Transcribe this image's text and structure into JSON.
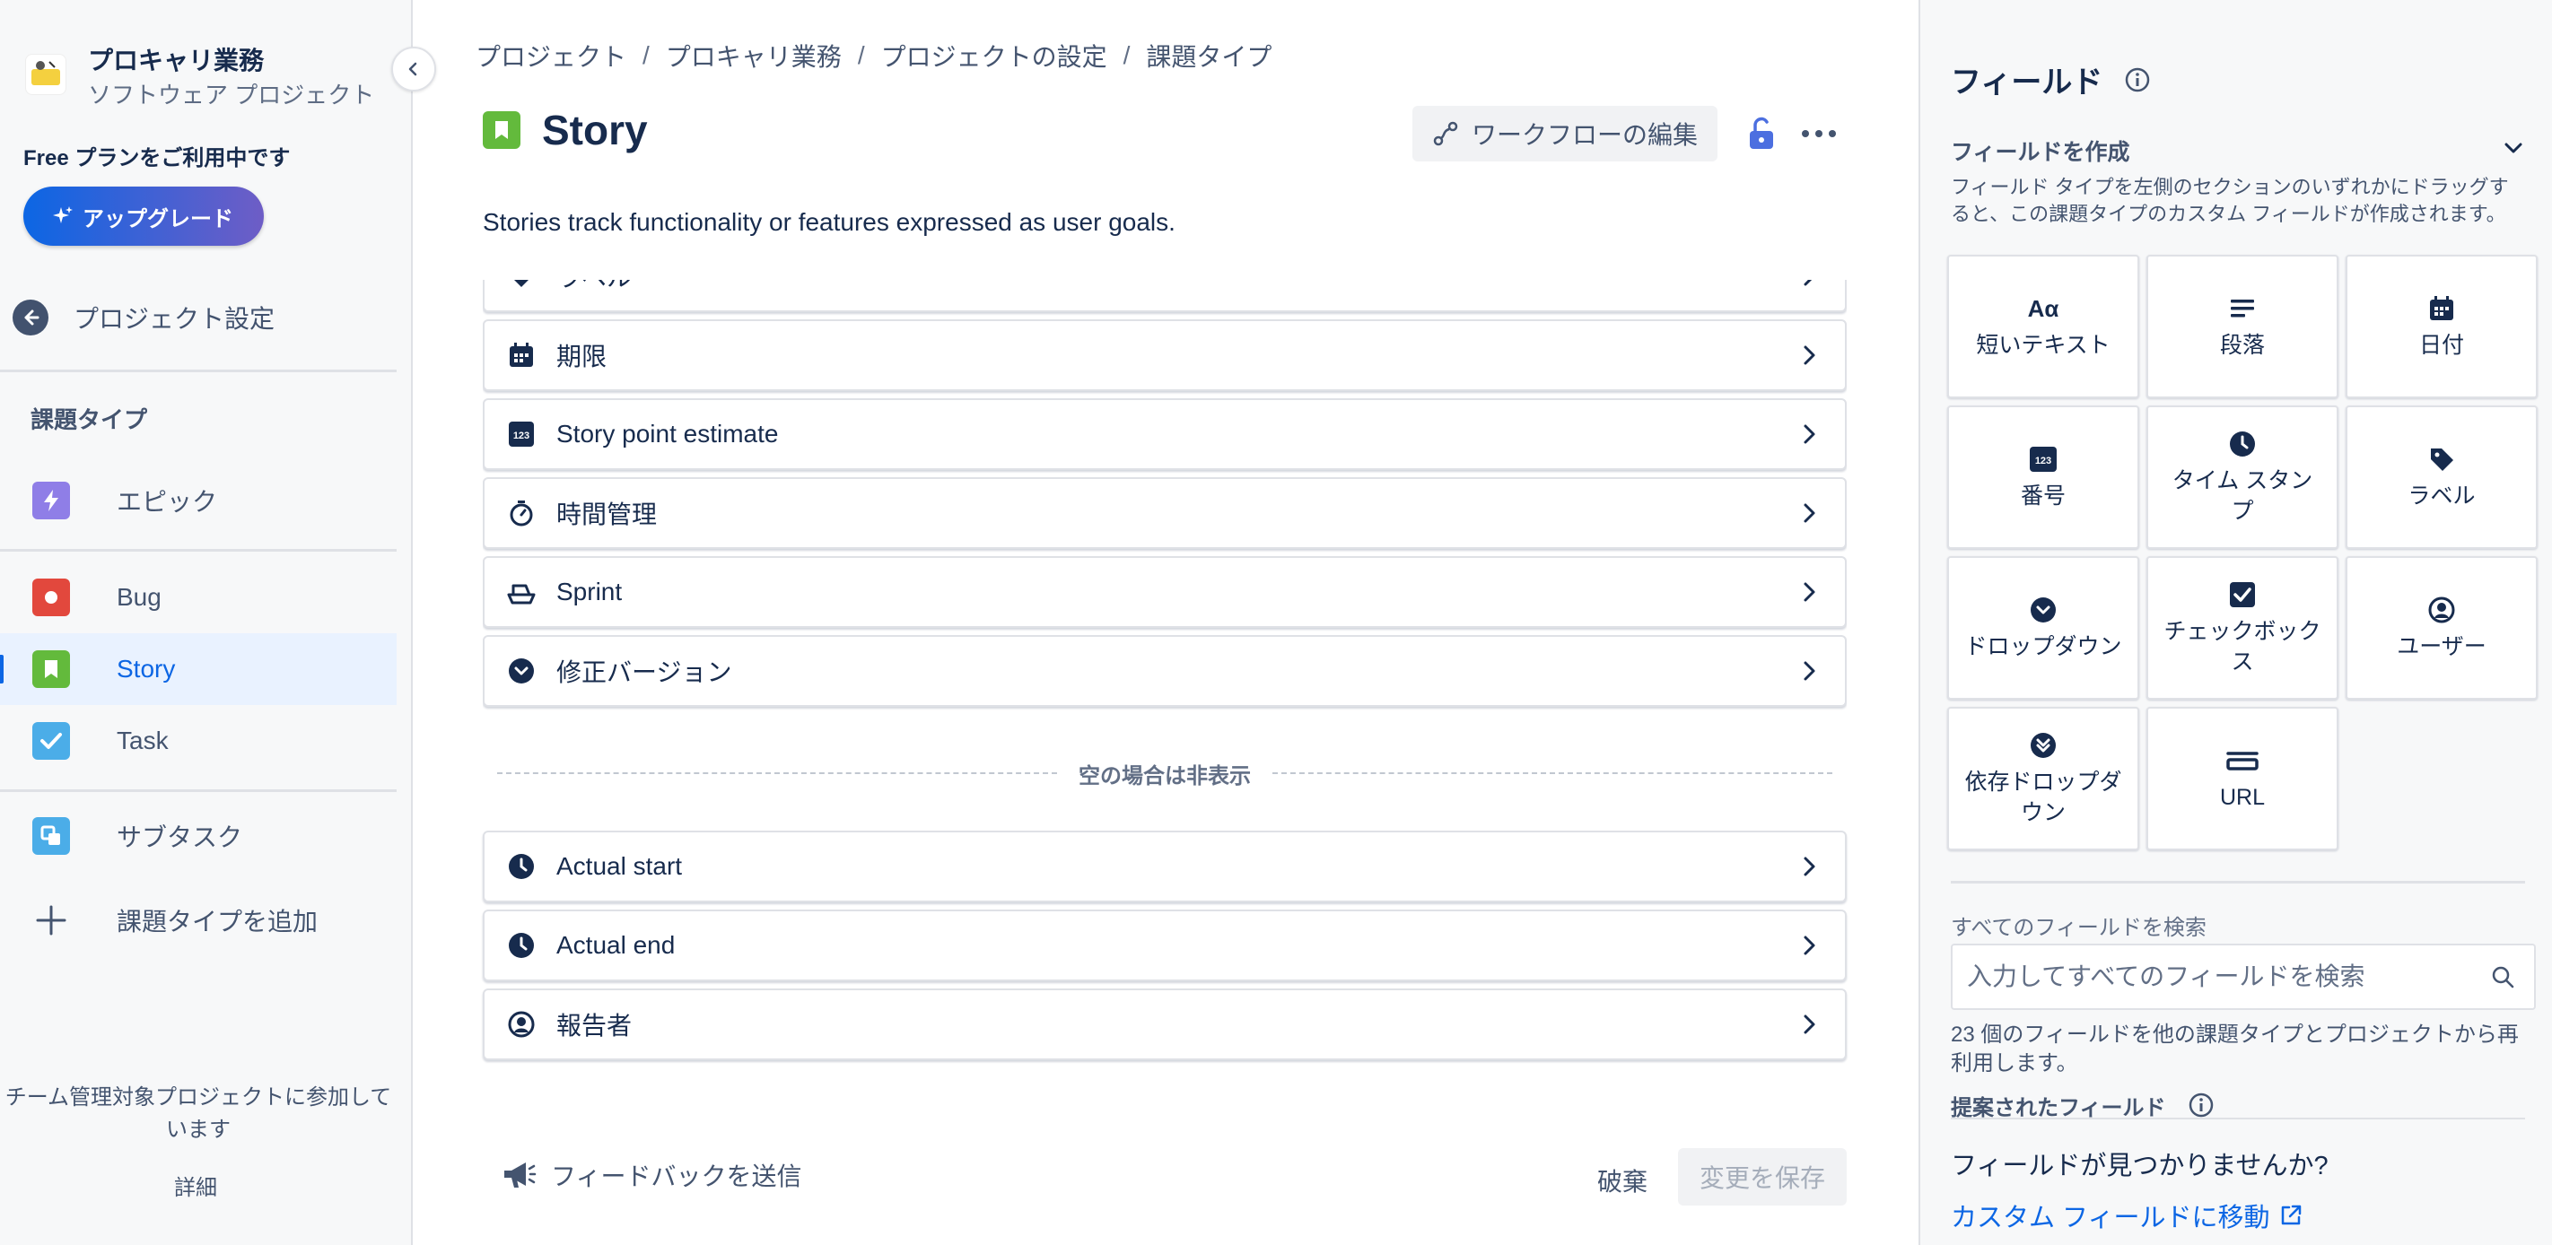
{
  "sidebar": {
    "project_name": "プロキャリ業務",
    "project_type": "ソフトウェア プロジェクト",
    "plan_text": "Free プランをご利用中です",
    "upgrade_label": "アップグレード",
    "back_label": "プロジェクト設定",
    "section_title": "課題タイプ",
    "items": [
      {
        "label": "エピック",
        "icon": "epic-icon",
        "color": "#8f7ee7"
      },
      {
        "label": "Bug",
        "icon": "bug-icon",
        "color": "#e2483d"
      },
      {
        "label": "Story",
        "icon": "story-icon",
        "color": "#63ba3c",
        "active": true
      },
      {
        "label": "Task",
        "icon": "task-icon",
        "color": "#4bade8"
      },
      {
        "label": "サブタスク",
        "icon": "subtask-icon",
        "color": "#4bade8"
      },
      {
        "label": "課題タイプを追加",
        "icon": "plus-icon"
      }
    ],
    "team_note": "チーム管理対象プロジェクトに参加しています",
    "detail_link": "詳細"
  },
  "main": {
    "breadcrumb": [
      "プロジェクト",
      "プロキャリ業務",
      "プロジェクトの設定",
      "課題タイプ"
    ],
    "title": "Story",
    "workflow_button": "ワークフローの編集",
    "description": "Stories track functionality or features expressed as user goals.",
    "fields": [
      {
        "label": "ラベル",
        "icon": "label-icon"
      },
      {
        "label": "期限",
        "icon": "calendar-icon"
      },
      {
        "label": "Story point estimate",
        "icon": "number-icon"
      },
      {
        "label": "時間管理",
        "icon": "stopwatch-icon"
      },
      {
        "label": "Sprint",
        "icon": "sprint-icon"
      },
      {
        "label": "修正バージョン",
        "icon": "dropdown-icon"
      }
    ],
    "hidden_divider": "空の場合は非表示",
    "hidden_fields": [
      {
        "label": "Actual start",
        "icon": "clock-icon"
      },
      {
        "label": "Actual end",
        "icon": "clock-icon"
      },
      {
        "label": "報告者",
        "icon": "user-icon"
      }
    ],
    "feedback": "フィードバックを送信",
    "discard": "破棄",
    "save": "変更を保存"
  },
  "panel": {
    "title": "フィールド",
    "create_heading": "フィールドを作成",
    "create_desc": "フィールド タイプを左側のセクションのいずれかにドラッグすると、この課題タイプのカスタム フィールドが作成されます。",
    "tiles": [
      {
        "label": "短いテキスト",
        "icon": "text-icon"
      },
      {
        "label": "段落",
        "icon": "paragraph-icon"
      },
      {
        "label": "日付",
        "icon": "calendar-icon"
      },
      {
        "label": "番号",
        "icon": "number-icon"
      },
      {
        "label": "タイム スタンプ",
        "icon": "clock-icon"
      },
      {
        "label": "ラベル",
        "icon": "label-icon"
      },
      {
        "label": "ドロップダウン",
        "icon": "dropdown-icon"
      },
      {
        "label": "チェックボックス",
        "icon": "checkbox-icon"
      },
      {
        "label": "ユーザー",
        "icon": "user-icon"
      },
      {
        "label": "依存ドロップダウン",
        "icon": "cascading-dropdown-icon"
      },
      {
        "label": "URL",
        "icon": "url-icon"
      }
    ],
    "search_label": "すべてのフィールドを検索",
    "search_placeholder": "入力してすべてのフィールドを検索",
    "reuse_text": "23 個のフィールドを他の課題タイプとプロジェクトから再利用します。",
    "suggested_title": "提案されたフィールド",
    "not_found": "フィールドが見つかりませんか?",
    "custom_link": "カスタム フィールドに移動"
  },
  "colors": {
    "accent": "#0c66e4",
    "story": "#63ba3c",
    "text": "#172b4d",
    "subtle": "#44546f"
  }
}
